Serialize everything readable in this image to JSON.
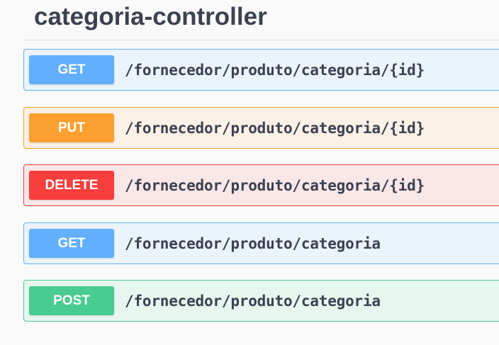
{
  "section": {
    "title": "categoria-controller"
  },
  "operations": [
    {
      "method": "GET",
      "path": "/fornecedor/produto/categoria/{id}",
      "color": "#61affe"
    },
    {
      "method": "PUT",
      "path": "/fornecedor/produto/categoria/{id}",
      "color": "#fca130"
    },
    {
      "method": "DELETE",
      "path": "/fornecedor/produto/categoria/{id}",
      "color": "#f93e3e"
    },
    {
      "method": "GET",
      "path": "/fornecedor/produto/categoria",
      "color": "#61affe"
    },
    {
      "method": "POST",
      "path": "/fornecedor/produto/categoria",
      "color": "#49cc90"
    }
  ]
}
